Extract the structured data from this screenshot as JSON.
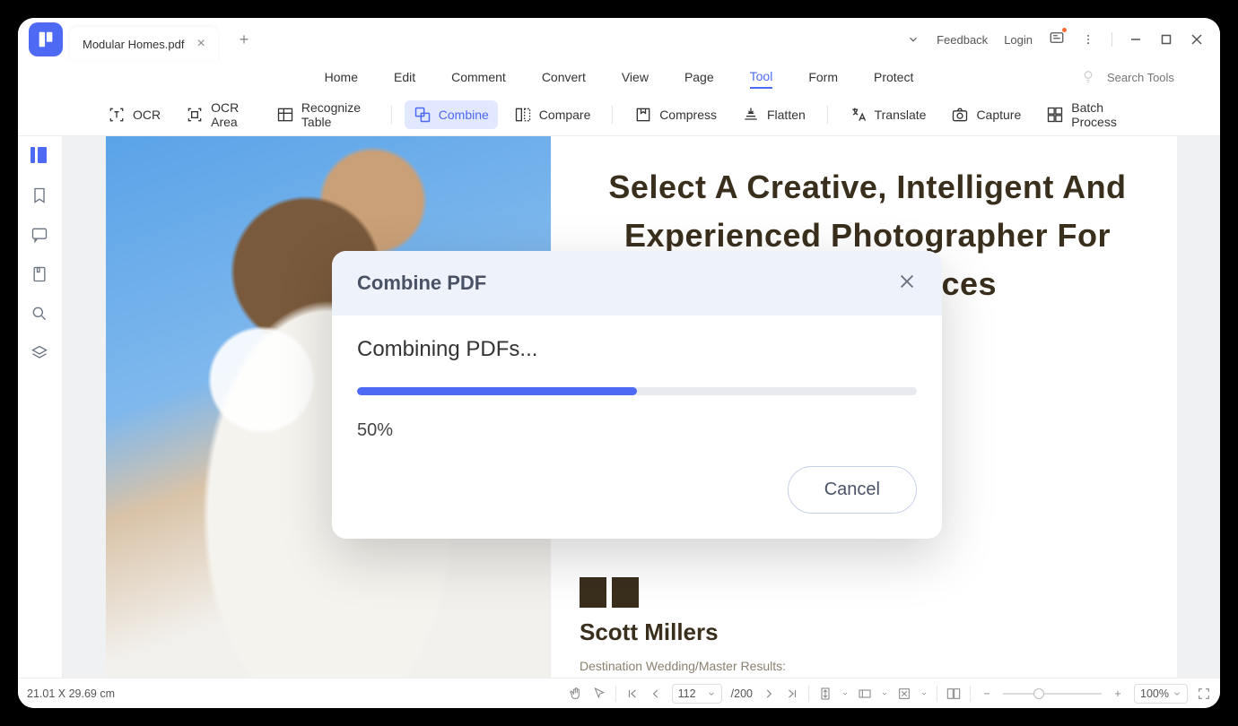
{
  "titlebar": {
    "tab_title": "Modular Homes.pdf",
    "feedback": "Feedback",
    "login": "Login"
  },
  "menubar": {
    "items": [
      "Home",
      "Edit",
      "Comment",
      "Convert",
      "View",
      "Page",
      "Tool",
      "Form",
      "Protect"
    ],
    "active_index": 6,
    "search_placeholder": "Search Tools"
  },
  "toolbar": {
    "ocr": "OCR",
    "ocr_area": "OCR Area",
    "recognize_table": "Recognize Table",
    "combine": "Combine",
    "compare": "Compare",
    "compress": "Compress",
    "flatten": "Flatten",
    "translate": "Translate",
    "capture": "Capture",
    "batch": "Batch Process"
  },
  "document": {
    "headline": "Select A Creative, Intelligent And Experienced Photographer For Quality Services",
    "author": "Scott Millers",
    "subline": "Destination Wedding/Master Results:"
  },
  "dialog": {
    "title": "Combine PDF",
    "message": "Combining PDFs...",
    "percent": "50%",
    "progress_value": 50,
    "cancel": "Cancel"
  },
  "statusbar": {
    "dimensions": "21.01 X 29.69 cm",
    "page_current": "112",
    "page_total": "/200",
    "zoom": "100%"
  }
}
